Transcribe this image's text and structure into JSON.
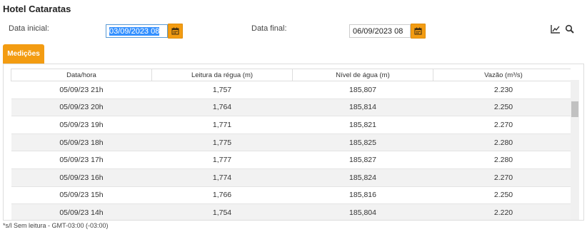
{
  "page": {
    "title": "Hotel Cataratas",
    "footnote": "*s/l Sem leitura - GMT-03:00 (-03:00)"
  },
  "filters": {
    "start_label": "Data inicial:",
    "start_value": "03/09/2023 08",
    "end_label": "Data final:",
    "end_value": "06/09/2023 08"
  },
  "icons": {
    "calendar": "calendar-icon",
    "chart": "line-chart-icon",
    "search": "search-icon"
  },
  "colors": {
    "accent": "#f39c12",
    "selection": "#3390ff"
  },
  "tabs": [
    {
      "label": "Medições",
      "active": true
    }
  ],
  "table": {
    "columns": [
      "Data/hora",
      "Leitura da régua (m)",
      "Nível de água (m)",
      "Vazão (m³/s)"
    ],
    "rows": [
      [
        "05/09/23 21h",
        "1,757",
        "185,807",
        "2.230"
      ],
      [
        "05/09/23 20h",
        "1,764",
        "185,814",
        "2.250"
      ],
      [
        "05/09/23 19h",
        "1,771",
        "185,821",
        "2.270"
      ],
      [
        "05/09/23 18h",
        "1,775",
        "185,825",
        "2.280"
      ],
      [
        "05/09/23 17h",
        "1,777",
        "185,827",
        "2.280"
      ],
      [
        "05/09/23 16h",
        "1,774",
        "185,824",
        "2.270"
      ],
      [
        "05/09/23 15h",
        "1,766",
        "185,816",
        "2.250"
      ],
      [
        "05/09/23 14h",
        "1,754",
        "185,804",
        "2.220"
      ]
    ]
  }
}
